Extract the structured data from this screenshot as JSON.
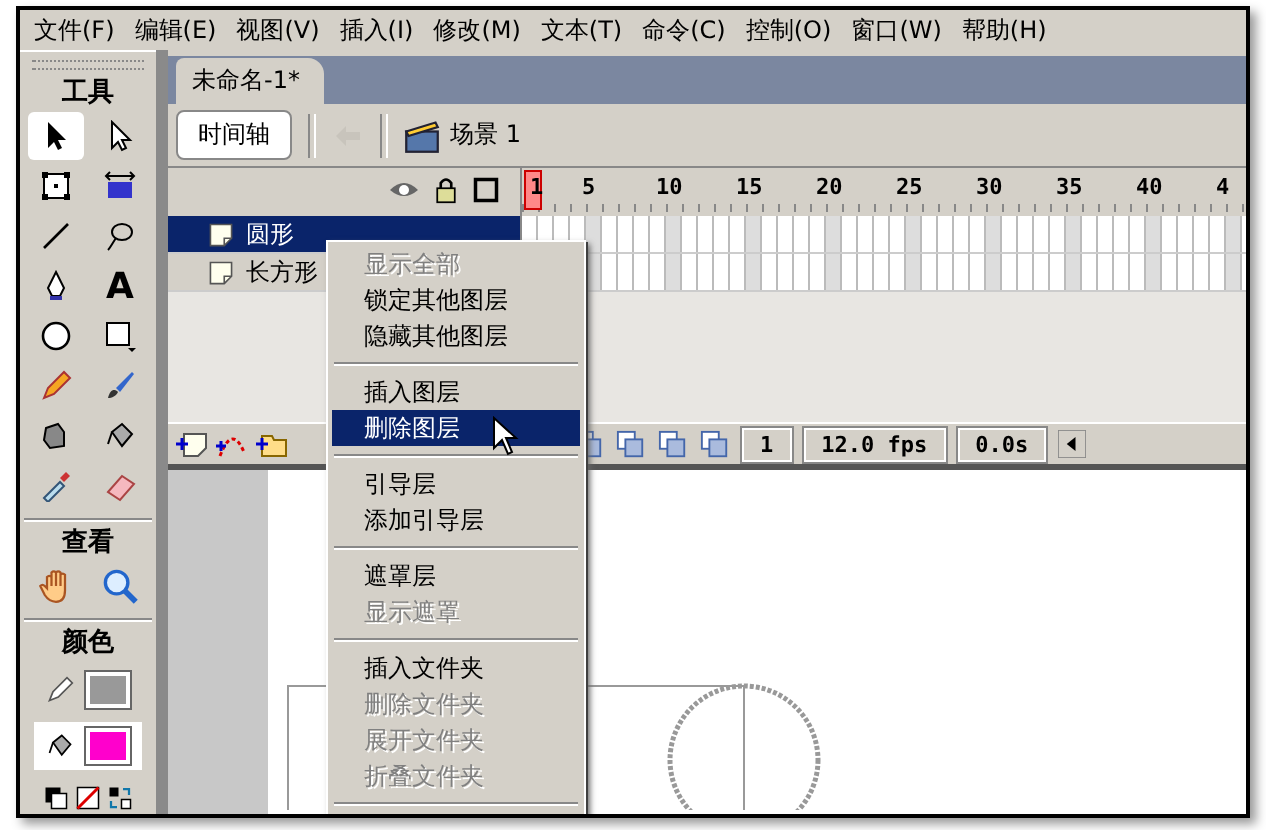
{
  "menu_bar": [
    "文件(F)",
    "编辑(E)",
    "视图(V)",
    "插入(I)",
    "修改(M)",
    "文本(T)",
    "命令(C)",
    "控制(O)",
    "窗口(W)",
    "帮助(H)"
  ],
  "toolbox": {
    "title": "工具",
    "tools": [
      {
        "selected": true
      },
      {
        "selected": false
      },
      {
        "selected": false
      },
      {
        "selected": false
      },
      {
        "selected": false
      },
      {
        "selected": false
      },
      {
        "selected": false
      },
      {
        "selected": false,
        "glyph": "A"
      },
      {
        "selected": false
      },
      {
        "selected": false
      },
      {
        "selected": false
      },
      {
        "selected": false
      },
      {
        "selected": false
      },
      {
        "selected": false
      },
      {
        "selected": false
      },
      {
        "selected": false
      }
    ],
    "view_title": "查看",
    "colors_title": "颜色",
    "color_wells": [
      {
        "kind": "stroke",
        "color": "#999999",
        "selected": false
      },
      {
        "kind": "fill",
        "color": "#ff00cc",
        "selected": true
      }
    ]
  },
  "document": {
    "tab": "未命名-1*",
    "timeline_button": "时间轴",
    "scene": "场景 1"
  },
  "timeline": {
    "frame_numbers": [
      "1",
      "5",
      "10",
      "15",
      "20",
      "25",
      "30",
      "35",
      "40",
      "4"
    ],
    "layers": [
      {
        "name": "圆形",
        "selected": true
      },
      {
        "name": "长方形",
        "selected": false
      }
    ],
    "current_frame": "1",
    "frame_rate": "12.0 fps",
    "elapsed_time": "0.0s"
  },
  "context_menu": [
    {
      "kind": "item",
      "label": "显示全部",
      "disabled": true,
      "selected": false
    },
    {
      "kind": "item",
      "label": "锁定其他图层",
      "disabled": false,
      "selected": false
    },
    {
      "kind": "item",
      "label": "隐藏其他图层",
      "disabled": false,
      "selected": false
    },
    {
      "kind": "separator"
    },
    {
      "kind": "item",
      "label": "插入图层",
      "disabled": false,
      "selected": false
    },
    {
      "kind": "item",
      "label": "删除图层",
      "disabled": false,
      "selected": true
    },
    {
      "kind": "separator"
    },
    {
      "kind": "item",
      "label": "引导层",
      "disabled": false,
      "selected": false
    },
    {
      "kind": "item",
      "label": "添加引导层",
      "disabled": false,
      "selected": false
    },
    {
      "kind": "separator"
    },
    {
      "kind": "item",
      "label": "遮罩层",
      "disabled": false,
      "selected": false
    },
    {
      "kind": "item",
      "label": "显示遮罩",
      "disabled": true,
      "selected": false
    },
    {
      "kind": "separator"
    },
    {
      "kind": "item",
      "label": "插入文件夹",
      "disabled": false,
      "selected": false
    },
    {
      "kind": "item",
      "label": "删除文件夹",
      "disabled": true,
      "selected": false
    },
    {
      "kind": "item",
      "label": "展开文件夹",
      "disabled": true,
      "selected": false
    },
    {
      "kind": "item",
      "label": "折叠文件夹",
      "disabled": true,
      "selected": false
    },
    {
      "kind": "separator"
    }
  ]
}
